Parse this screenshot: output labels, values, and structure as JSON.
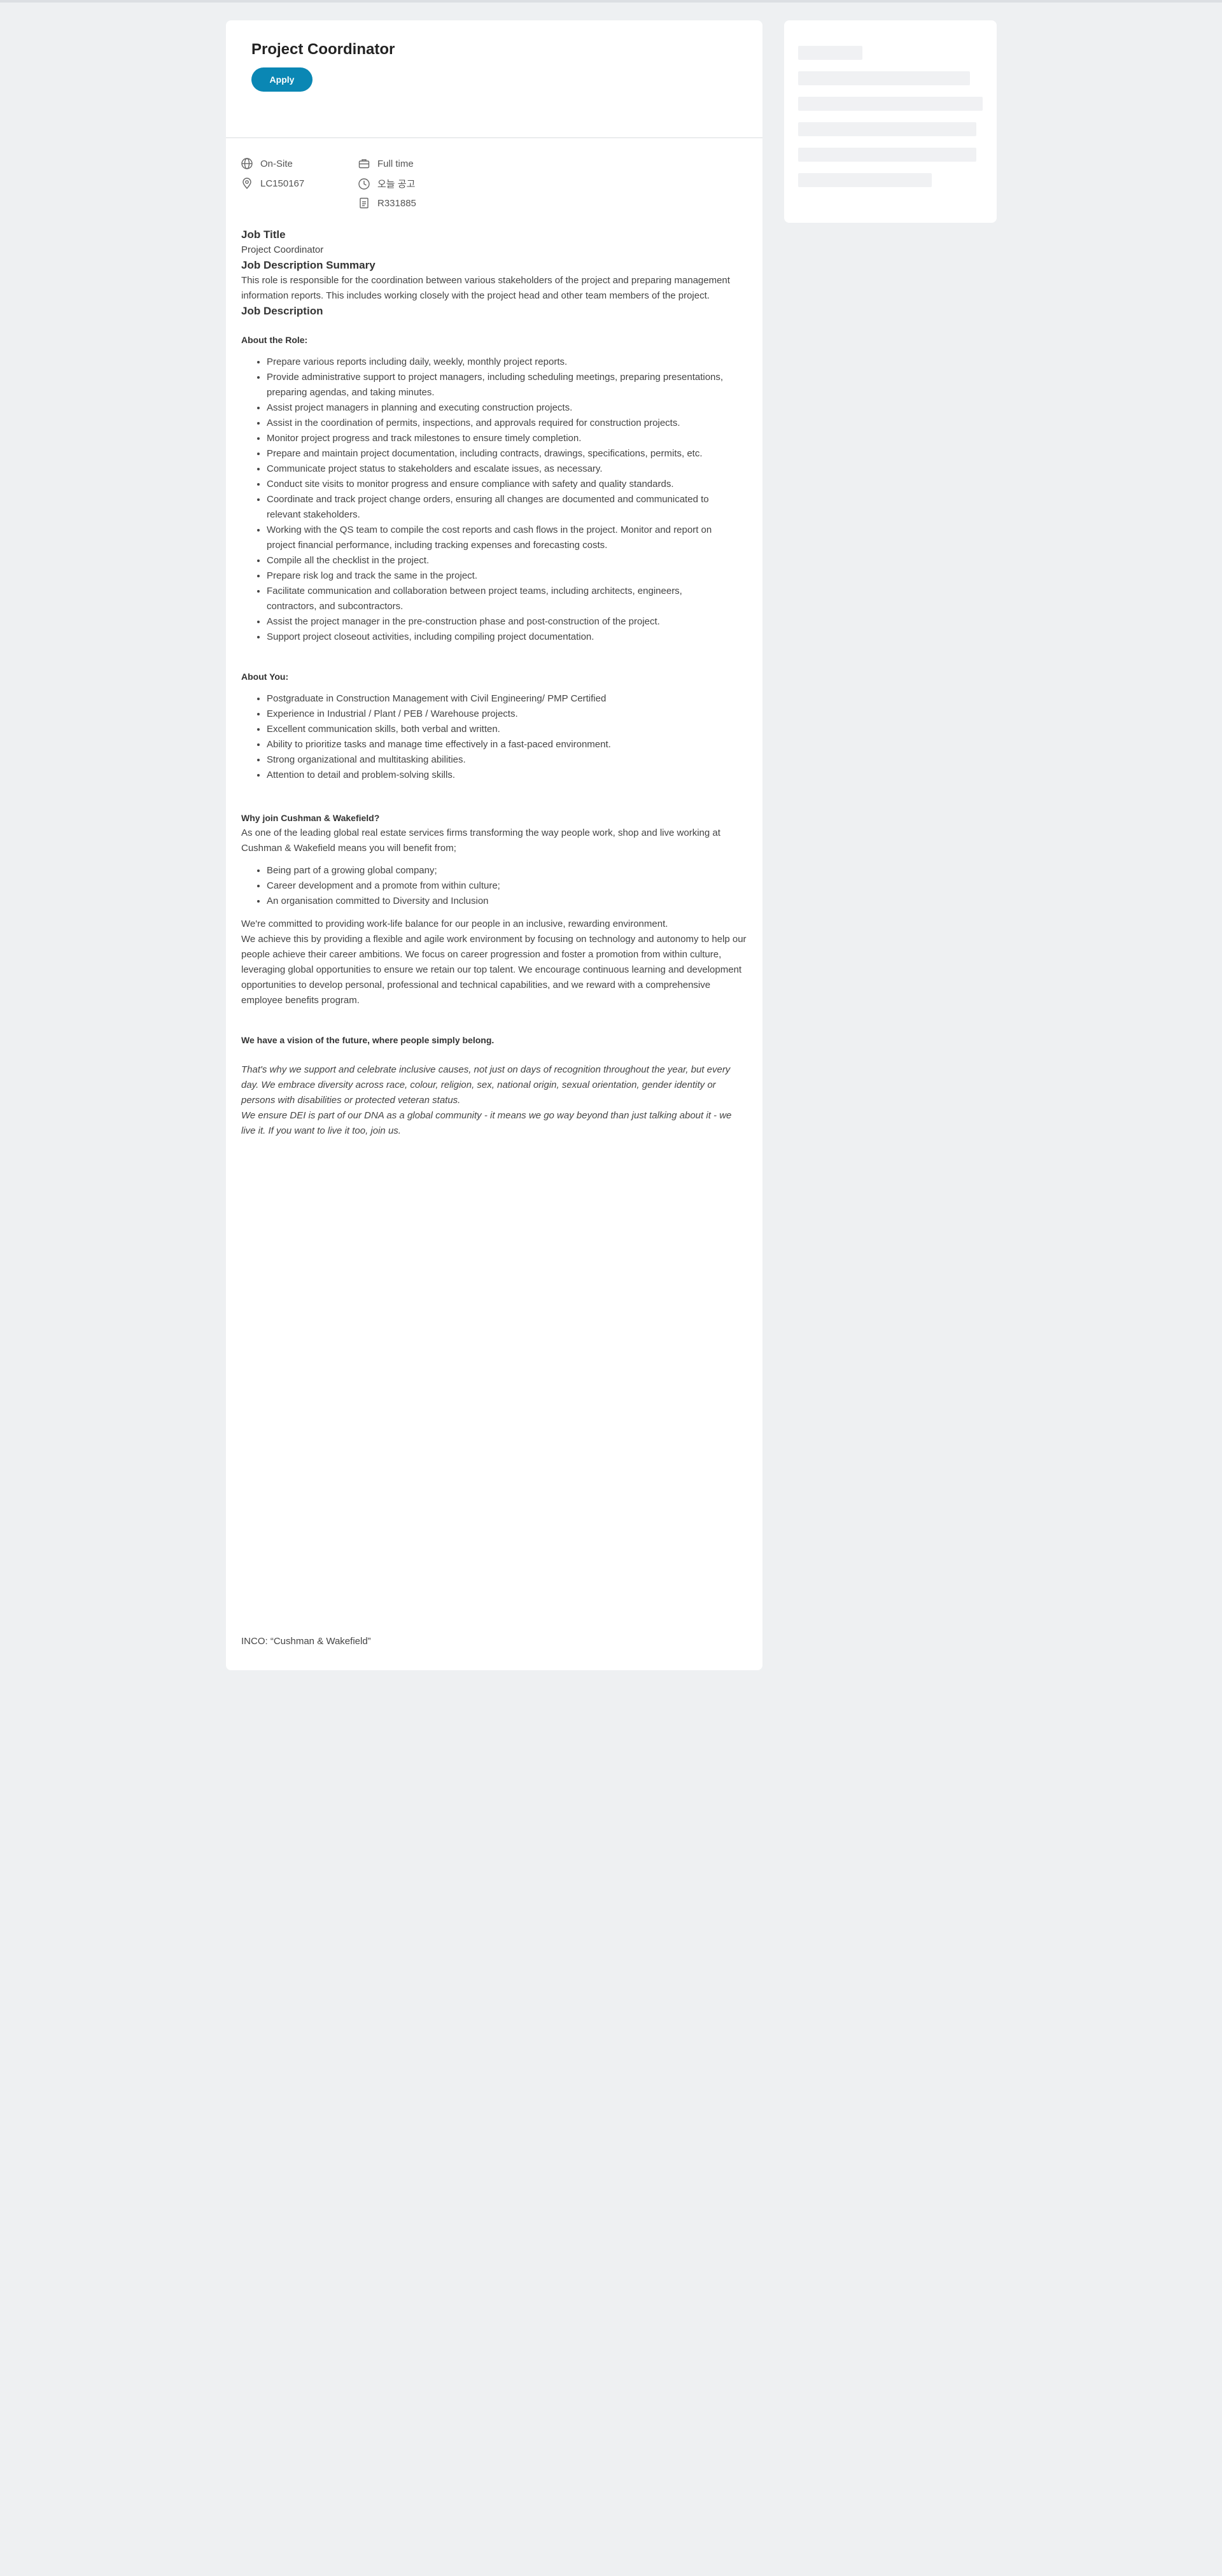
{
  "job": {
    "title": "Project Coordinator",
    "apply_label": "Apply"
  },
  "meta": {
    "location_type": "On-Site",
    "location_code": "LC150167",
    "time_type": "Full time",
    "posted": "오늘 공고",
    "req_id": "R331885"
  },
  "icons": {
    "globe": "globe-icon",
    "pin": "location-pin-icon",
    "briefcase": "briefcase-icon",
    "clock": "clock-icon",
    "document": "document-icon"
  },
  "colors": {
    "accent": "#0a87b4",
    "background": "#eef0f2"
  },
  "description": {
    "job_title_heading": "Job Title",
    "job_title_value": "Project Coordinator",
    "summary_heading": "Job Description Summary",
    "summary_text": "This role is responsible for the coordination between various stakeholders of the project and preparing management information reports. This includes working closely with the project head and other team members of the project.",
    "description_heading": "Job Description",
    "about_role_heading": "About the Role:",
    "about_role_items": [
      "Prepare various reports including daily, weekly, monthly project reports.",
      "Provide administrative support to project managers, including scheduling meetings, preparing presentations, preparing agendas, and taking minutes.",
      "Assist project managers in planning and executing construction projects.",
      "Assist in the coordination of permits, inspections, and approvals required for construction projects.",
      "Monitor project progress and track milestones to ensure timely completion.",
      "Prepare and maintain project documentation, including contracts, drawings, specifications, permits, etc.",
      "Communicate project status to stakeholders and escalate issues, as necessary.",
      "Conduct site visits to monitor progress and ensure compliance with safety and quality standards.",
      "Coordinate and track project change orders, ensuring all changes are documented and communicated to relevant stakeholders.",
      "Working with the QS team to compile the cost reports and cash flows in the project. Monitor and report on project financial performance, including tracking expenses and forecasting costs.",
      "Compile all the checklist in the project.",
      "Prepare  risk log and track the same in the project.",
      "Facilitate communication and collaboration between project teams, including architects, engineers, contractors, and subcontractors.",
      "Assist the project manager in the pre-construction phase and post-construction of the project.",
      "Support project closeout activities, including compiling project documentation."
    ],
    "about_you_heading": "About You:",
    "about_you_items": [
      "Postgraduate in Construction Management with Civil Engineering/ PMP Certified",
      "Experience in Industrial / Plant / PEB / Warehouse projects.",
      "Excellent communication skills, both verbal and written.",
      "Ability to prioritize tasks and manage time effectively in a fast-paced environment.",
      "Strong organizational and multitasking abilities.",
      "Attention to detail and problem-solving skills."
    ],
    "why_heading": "Why join Cushman & Wakefield?",
    "why_text": "As one of the leading global real estate services firms transforming the way people work, shop and live working at Cushman & Wakefield means you will benefit from;",
    "why_items": [
      "Being part of a growing global company;",
      "Career development and a promote from within culture;",
      "An organisation committed to Diversity and Inclusion"
    ],
    "commit_text_1": "We're committed to providing work-life balance for our people in an inclusive, rewarding environment.",
    "commit_text_2": "We achieve this by providing a flexible and agile work environment by focusing on technology and autonomy to help our people achieve their career ambitions. We focus on career progression and foster a promotion from within culture, leveraging global opportunities to ensure we retain our top talent. We encourage continuous learning and development opportunities to develop personal, professional and technical capabilities, and we reward with a comprehensive employee benefits program.",
    "vision_heading": "We have a vision of the future, where people simply belong.",
    "vision_text_1": "That's why we support and celebrate inclusive causes, not just on days of recognition throughout the year, but every day. We embrace diversity across race, colour, religion, sex, national origin, sexual orientation, gender identity or persons with disabilities or protected veteran status.",
    "vision_text_2": "We ensure DEI is part of our DNA as a global community - it means we go way beyond than just talking about it - we live it. If you want to live it too, join us.",
    "footer_text": "INCO: “Cushman & Wakefield”"
  }
}
